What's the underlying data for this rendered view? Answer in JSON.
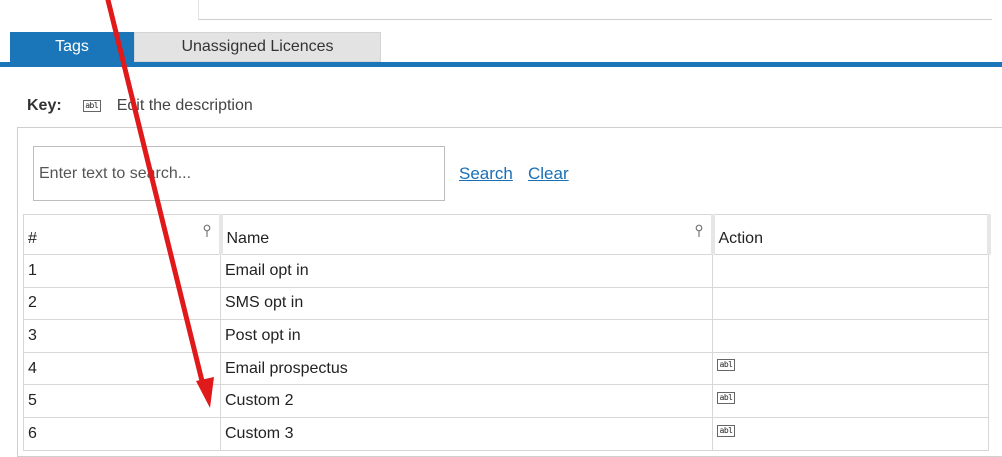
{
  "tabs": [
    {
      "label": "Tags",
      "active": true
    },
    {
      "label": "Unassigned Licences",
      "active": false
    }
  ],
  "key": {
    "label": "Key:",
    "icon": "abl-text-field-icon",
    "icon_text": "abl",
    "description": "Edit the description"
  },
  "search": {
    "placeholder": "Enter text to search...",
    "value": "",
    "search_label": "Search",
    "clear_label": "Clear"
  },
  "table": {
    "columns": [
      "#",
      "Name",
      "Action"
    ],
    "rows": [
      {
        "num": "1",
        "name": "Email opt in",
        "action_icon": false
      },
      {
        "num": "2",
        "name": "SMS opt in",
        "action_icon": false
      },
      {
        "num": "3",
        "name": "Post opt in",
        "action_icon": false
      },
      {
        "num": "4",
        "name": "Email prospectus",
        "action_icon": true
      },
      {
        "num": "5",
        "name": "Custom 2",
        "action_icon": true
      },
      {
        "num": "6",
        "name": "Custom 3",
        "action_icon": true
      }
    ]
  },
  "colors": {
    "accent": "#1a76b8",
    "link": "#1a6fb5",
    "annotation_arrow": "#e0191b"
  }
}
